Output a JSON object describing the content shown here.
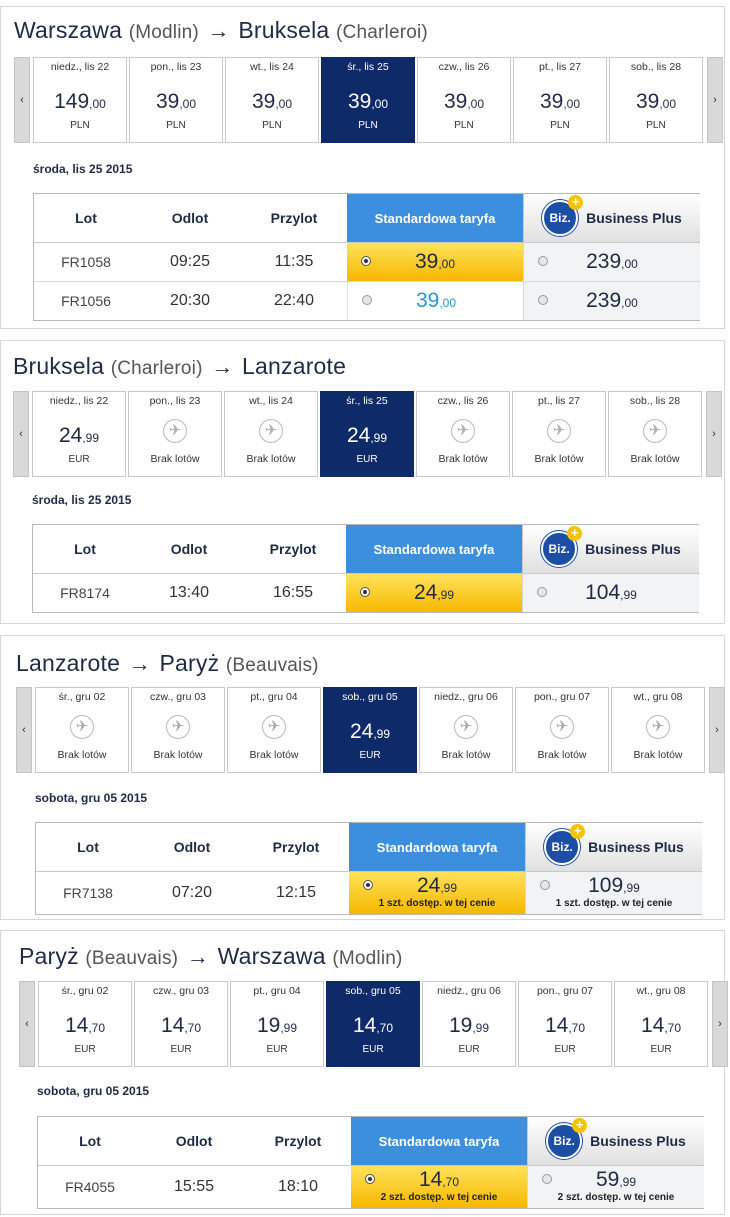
{
  "sections": [
    {
      "route": {
        "from": "Warszawa",
        "from_sub": "(Modlin)",
        "arrow": "→",
        "to": "Bruksela",
        "to_sub": "(Charleroi)"
      },
      "days": [
        {
          "label": "niedz., lis 22",
          "price_int": "149",
          "price_dec": ",00",
          "currency": "PLN"
        },
        {
          "label": "pon., lis 23",
          "price_int": "39",
          "price_dec": ",00",
          "currency": "PLN"
        },
        {
          "label": "wt., lis 24",
          "price_int": "39",
          "price_dec": ",00",
          "currency": "PLN"
        },
        {
          "label": "śr., lis 25",
          "price_int": "39",
          "price_dec": ",00",
          "currency": "PLN",
          "selected": true
        },
        {
          "label": "czw., lis 26",
          "price_int": "39",
          "price_dec": ",00",
          "currency": "PLN"
        },
        {
          "label": "pt., lis 27",
          "price_int": "39",
          "price_dec": ",00",
          "currency": "PLN"
        },
        {
          "label": "sob., lis 28",
          "price_int": "39",
          "price_dec": ",00",
          "currency": "PLN"
        }
      ],
      "date_heading": "środa, lis 25 2015",
      "headers": {
        "flight": "Lot",
        "depart": "Odlot",
        "arrive": "Przylot",
        "standard": "Standardowa taryfa",
        "biz_logo": "Biz.",
        "business": "Business Plus"
      },
      "flights": [
        {
          "number": "FR1058",
          "depart": "09:25",
          "arrive": "11:35",
          "std_int": "39",
          "std_dec": ",00",
          "std_selected": true,
          "biz_int": "239",
          "biz_dec": ",00"
        },
        {
          "number": "FR1056",
          "depart": "20:30",
          "arrive": "22:40",
          "std_int": "39",
          "std_dec": ",00",
          "std_selected": false,
          "biz_int": "239",
          "biz_dec": ",00"
        }
      ]
    },
    {
      "route": {
        "from": "Bruksela",
        "from_sub": "(Charleroi)",
        "arrow": "→",
        "to": "Lanzarote",
        "to_sub": ""
      },
      "days": [
        {
          "label": "niedz., lis 22",
          "price_int": "24",
          "price_dec": ",99",
          "currency": "EUR"
        },
        {
          "label": "pon., lis 23",
          "no_flights": "Brak lotów"
        },
        {
          "label": "wt., lis 24",
          "no_flights": "Brak lotów"
        },
        {
          "label": "śr., lis 25",
          "price_int": "24",
          "price_dec": ",99",
          "currency": "EUR",
          "selected": true
        },
        {
          "label": "czw., lis 26",
          "no_flights": "Brak lotów"
        },
        {
          "label": "pt., lis 27",
          "no_flights": "Brak lotów"
        },
        {
          "label": "sob., lis 28",
          "no_flights": "Brak lotów"
        }
      ],
      "date_heading": "środa, lis 25 2015",
      "headers": {
        "flight": "Lot",
        "depart": "Odlot",
        "arrive": "Przylot",
        "standard": "Standardowa taryfa",
        "biz_logo": "Biz.",
        "business": "Business Plus"
      },
      "flights": [
        {
          "number": "FR8174",
          "depart": "13:40",
          "arrive": "16:55",
          "std_int": "24",
          "std_dec": ",99",
          "std_selected": true,
          "biz_int": "104",
          "biz_dec": ",99"
        }
      ]
    },
    {
      "route": {
        "from": "Lanzarote",
        "from_sub": "",
        "arrow": "→",
        "to": "Paryż",
        "to_sub": "(Beauvais)"
      },
      "days": [
        {
          "label": "śr., gru 02",
          "no_flights": "Brak lotów"
        },
        {
          "label": "czw., gru 03",
          "no_flights": "Brak lotów"
        },
        {
          "label": "pt., gru 04",
          "no_flights": "Brak lotów"
        },
        {
          "label": "sob., gru 05",
          "price_int": "24",
          "price_dec": ",99",
          "currency": "EUR",
          "selected": true
        },
        {
          "label": "niedz., gru 06",
          "no_flights": "Brak lotów"
        },
        {
          "label": "pon., gru 07",
          "no_flights": "Brak lotów"
        },
        {
          "label": "wt., gru 08",
          "no_flights": "Brak lotów"
        }
      ],
      "date_heading": "sobota, gru 05 2015",
      "headers": {
        "flight": "Lot",
        "depart": "Odlot",
        "arrive": "Przylot",
        "standard": "Standardowa taryfa",
        "biz_logo": "Biz.",
        "business": "Business Plus"
      },
      "flights": [
        {
          "number": "FR7138",
          "depart": "07:20",
          "arrive": "12:15",
          "std_int": "24",
          "std_dec": ",99",
          "std_selected": true,
          "std_avail": "1 szt. dostęp. w tej cenie",
          "biz_int": "109",
          "biz_dec": ",99",
          "biz_avail": "1 szt. dostęp. w tej cenie"
        }
      ]
    },
    {
      "route": {
        "from": "Paryż",
        "from_sub": "(Beauvais)",
        "arrow": "→",
        "to": "Warszawa",
        "to_sub": "(Modlin)"
      },
      "days": [
        {
          "label": "śr., gru 02",
          "price_int": "14",
          "price_dec": ",70",
          "currency": "EUR"
        },
        {
          "label": "czw., gru 03",
          "price_int": "14",
          "price_dec": ",70",
          "currency": "EUR"
        },
        {
          "label": "pt., gru 04",
          "price_int": "19",
          "price_dec": ",99",
          "currency": "EUR"
        },
        {
          "label": "sob., gru 05",
          "price_int": "14",
          "price_dec": ",70",
          "currency": "EUR",
          "selected": true
        },
        {
          "label": "niedz., gru 06",
          "price_int": "19",
          "price_dec": ",99",
          "currency": "EUR"
        },
        {
          "label": "pon., gru 07",
          "price_int": "14",
          "price_dec": ",70",
          "currency": "EUR"
        },
        {
          "label": "wt., gru 08",
          "price_int": "14",
          "price_dec": ",70",
          "currency": "EUR"
        }
      ],
      "date_heading": "sobota, gru 05 2015",
      "headers": {
        "flight": "Lot",
        "depart": "Odlot",
        "arrive": "Przylot",
        "standard": "Standardowa taryfa",
        "biz_logo": "Biz.",
        "business": "Business Plus"
      },
      "flights": [
        {
          "number": "FR4055",
          "depart": "15:55",
          "arrive": "18:10",
          "std_int": "14",
          "std_dec": ",70",
          "std_selected": true,
          "std_avail": "2 szt. dostęp. w tej cenie",
          "biz_int": "59",
          "biz_dec": ",99",
          "biz_avail": "2 szt. dostęp. w tej cenie"
        }
      ]
    }
  ],
  "nav": {
    "prev": "‹",
    "next": "›"
  },
  "icons": {
    "plane": "plane-icon",
    "biz_plus": "plus-icon"
  },
  "colors": {
    "selected_day": "#0f2a68",
    "standard_header": "#3b8fde",
    "standard_fare": "#f6b800",
    "blue_price": "#2b95d8"
  }
}
